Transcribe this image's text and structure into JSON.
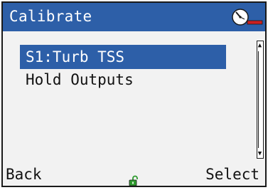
{
  "title": "Calibrate",
  "menu": {
    "items": [
      {
        "label": "S1:Turb TSS",
        "selected": true
      },
      {
        "label": "Hold Outputs",
        "selected": false
      }
    ]
  },
  "softkeys": {
    "left": "Back",
    "right": "Select"
  },
  "icons": {
    "title_icon": "calibration-gauge-icon",
    "status_icon": "unlocked-padlock-icon"
  },
  "colors": {
    "accent": "#2d5fa8",
    "background": "#f2f2f2",
    "lock": "#2e9b2e",
    "icon_red": "#cc2020"
  }
}
